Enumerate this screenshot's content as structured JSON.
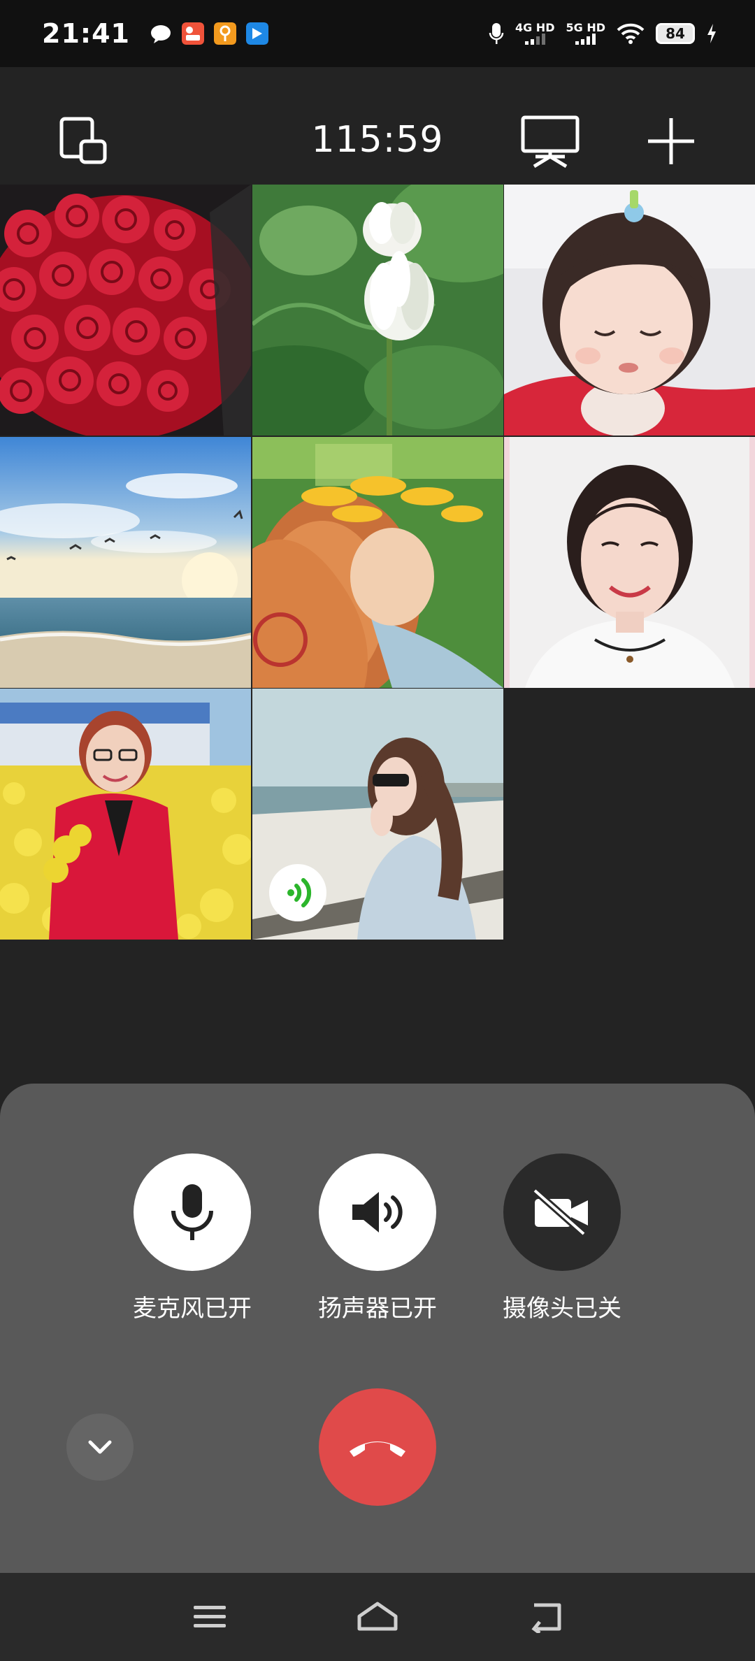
{
  "status_bar": {
    "time": "21:41",
    "network_1": "4G HD",
    "network_2": "5G HD",
    "battery": "84"
  },
  "toolbar": {
    "call_duration": "115:59"
  },
  "participants": [
    {
      "id": "p1",
      "label": "red-roses"
    },
    {
      "id": "p2",
      "label": "white-lotus"
    },
    {
      "id": "p3",
      "label": "toddler"
    },
    {
      "id": "p4",
      "label": "seaside-sunset"
    },
    {
      "id": "p5",
      "label": "sunflower-hat"
    },
    {
      "id": "p6",
      "label": "smiling-woman"
    },
    {
      "id": "p7",
      "label": "woman-in-rapeseed-field"
    },
    {
      "id": "p8",
      "label": "woman-at-beach",
      "speaking": true
    }
  ],
  "controls": {
    "mic_label": "麦克风已开",
    "speaker_label": "扬声器已开",
    "camera_label": "摄像头已关"
  },
  "colors": {
    "background": "#232323",
    "panel": "#595959",
    "hangup": "#e04a4a",
    "speaking": "#2bb52b"
  }
}
